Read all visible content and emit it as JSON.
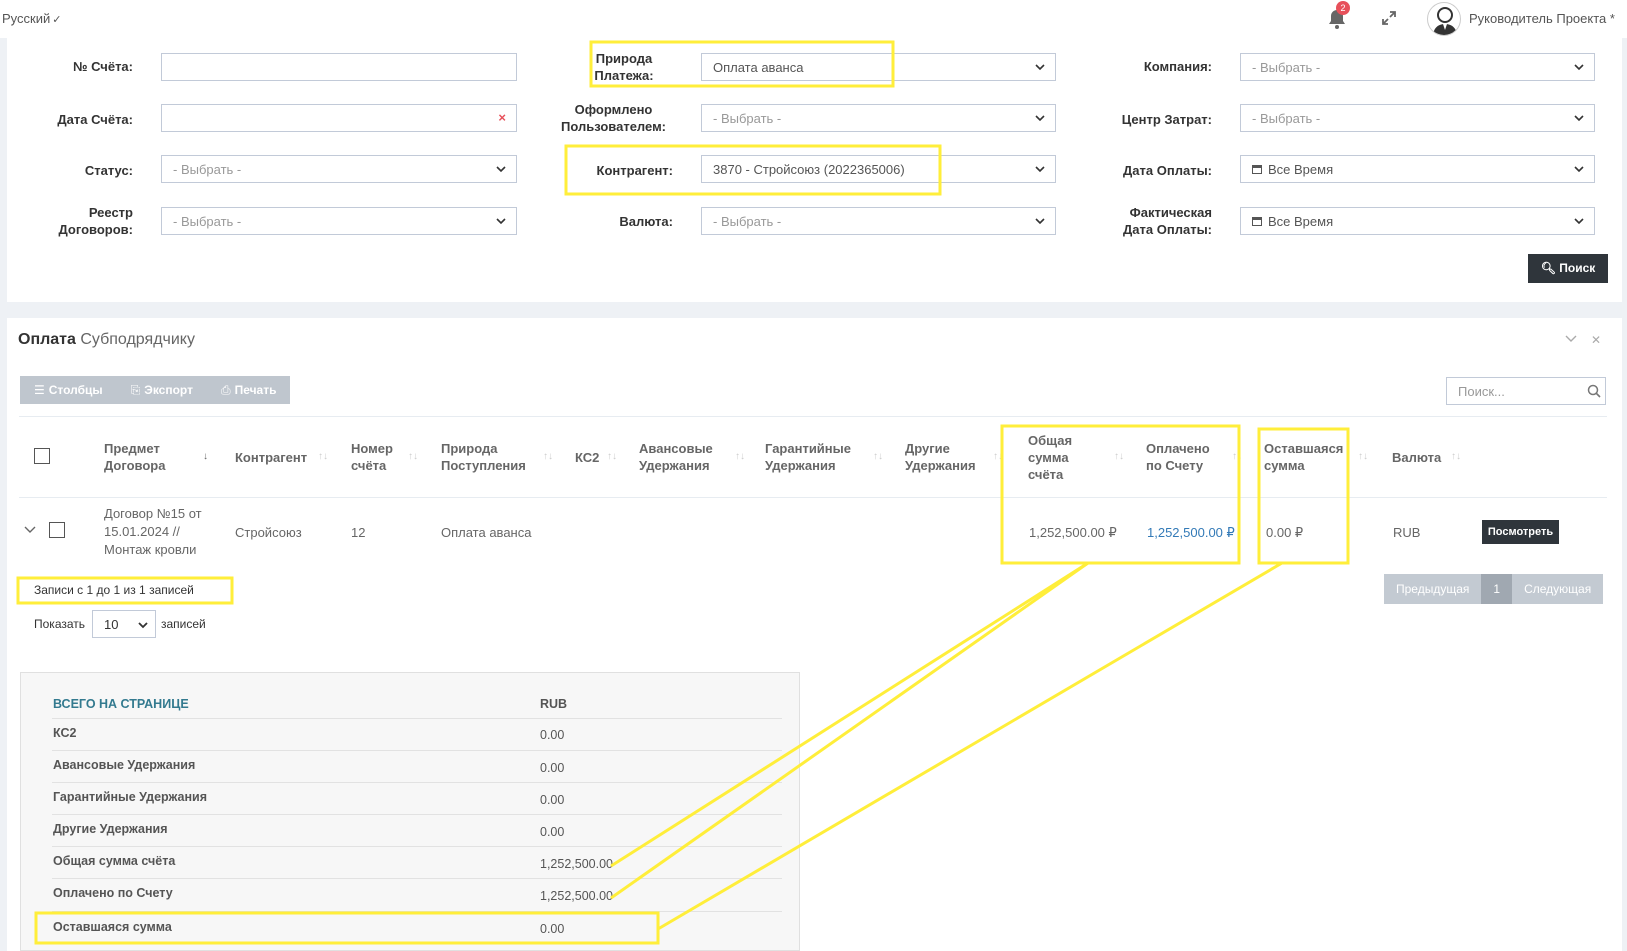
{
  "topbar": {
    "language": "Русский",
    "notifications_count": "2",
    "user_name": "Руководитель Проекта *"
  },
  "filters": {
    "invoice_no": {
      "label": "№ Счёта:",
      "value": ""
    },
    "invoice_date": {
      "label": "Дата Счёта:",
      "value": "",
      "clear": "×"
    },
    "status": {
      "label": "Статус:",
      "value": "- Выбрать -"
    },
    "contract_registry": {
      "label_1": "Реестр",
      "label_2": "Договоров:",
      "value": "- Выбрать -"
    },
    "payment_nature": {
      "label_1": "Природа",
      "label_2": "Платежа:",
      "value": "Оплата аванса"
    },
    "created_by": {
      "label_1": "Оформлено",
      "label_2": "Пользователем:",
      "value": "- Выбрать -"
    },
    "counterparty": {
      "label": "Контрагент:",
      "value": "3870 - Стройсоюз (2022365006)"
    },
    "currency": {
      "label": "Валюта:",
      "value": "- Выбрать -"
    },
    "company": {
      "label": "Компания:",
      "value": "- Выбрать -"
    },
    "cost_center": {
      "label": "Центр Затрат:",
      "value": "- Выбрать -"
    },
    "payment_date": {
      "label": "Дата Оплаты:",
      "value": "Все Время"
    },
    "actual_payment_date": {
      "label_1": "Фактическая",
      "label_2": "Дата Оплаты:",
      "value": "Все Время"
    },
    "search_button": "Поиск"
  },
  "panel": {
    "title_bold": "Оплата",
    "title_rest": "Субподрядчику",
    "toolbar": {
      "columns": "Столбцы",
      "export": "Экспорт",
      "print": "Печать"
    },
    "search_placeholder": "Поиск..."
  },
  "table": {
    "headers": {
      "subject_1": "Предмет",
      "subject_2": "Договора",
      "counterparty": "Контрагент",
      "number_1": "Номер",
      "number_2": "счёта",
      "nature_1": "Природа",
      "nature_2": "Поступления",
      "ks2": "КС2",
      "advance_1": "Авансовые",
      "advance_2": "Удержания",
      "guarantee_1": "Гарантийные",
      "guarantee_2": "Удержания",
      "other_1": "Другие",
      "other_2": "Удержания",
      "total_1": "Общая",
      "total_2": "сумма",
      "total_3": "счёта",
      "paid_1": "Оплачено",
      "paid_2": "по Счету",
      "remaining_1": "Оставшаяся",
      "remaining_2": "сумма",
      "currency": "Валюта"
    },
    "row": {
      "subject_1": "Договор №15 от",
      "subject_2": "15.01.2024 //",
      "subject_3": "Монтаж кровли",
      "counterparty": "Стройсоюз",
      "number": "12",
      "nature": "Оплата аванса",
      "total": "1,252,500.00 ₽",
      "paid": "1,252,500.00 ₽",
      "remaining": "0.00 ₽",
      "currency": "RUB",
      "view_button": "Посмотреть"
    },
    "info": "Записи с 1 до 1 из 1 записей",
    "show_label": "Показать",
    "show_value": "10",
    "show_after": "записей",
    "pager": {
      "prev": "Предыдущая",
      "current": "1",
      "next": "Следующая"
    }
  },
  "summary": {
    "header_label": "ВСЕГО НА СТРАНИЦЕ",
    "header_currency": "RUB",
    "rows": [
      {
        "label": "КС2",
        "value": "0.00"
      },
      {
        "label": "Авансовые Удержания",
        "value": "0.00"
      },
      {
        "label": "Гарантийные Удержания",
        "value": "0.00"
      },
      {
        "label": "Другие Удержания",
        "value": "0.00"
      },
      {
        "label": "Общая сумма счёта",
        "value": "1,252,500.00"
      },
      {
        "label": "Оплачено по Счету",
        "value": "1,252,500.00"
      },
      {
        "label": "Оставшаяся сумма",
        "value": "0.00"
      }
    ]
  },
  "colors": {
    "highlight": "#ffee3a",
    "dark_button": "#2f353b",
    "link": "#337ab7",
    "badge": "#e7505a"
  }
}
